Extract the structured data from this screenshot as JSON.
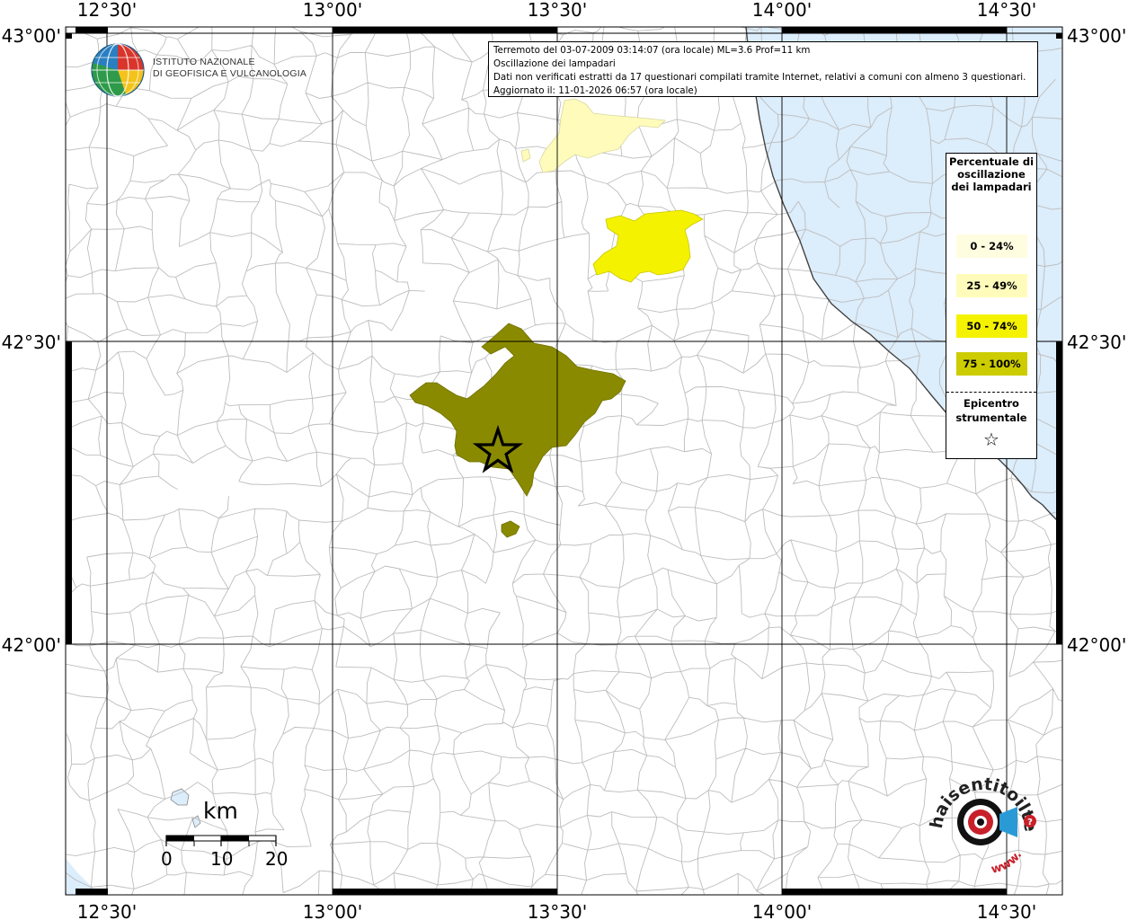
{
  "map": {
    "lon_ticks": [
      "12°30'",
      "13°00'",
      "13°30'",
      "14°00'",
      "14°30'"
    ],
    "lat_ticks": [
      "43°00'",
      "42°30'",
      "42°00'"
    ],
    "colors": {
      "sea": "#dcedfb",
      "land": "#ffffff",
      "border": "#bdbdbd",
      "grid": "#000000",
      "class_0_24": "#fffde0",
      "class_25_49": "#fffcbb",
      "class_50_74": "#f5f200",
      "class_75_100": "#8a8a00"
    },
    "epicentre_icon": "star-icon"
  },
  "info": {
    "line1": "Terremoto del 03-07-2009 03:14:07 (ora locale) ML=3.6 Prof=11 km",
    "line2": "Oscillazione dei lampadari",
    "line3": "Dati non verificati estratti da 17 questionari compilati tramite Internet, relativi a comuni con almeno 3 questionari.",
    "line4": "Aggiornato il: 11-01-2026 06:57 (ora locale)"
  },
  "legend": {
    "title": "Percentuale di oscillazione dei lampadari",
    "classes": [
      {
        "label": "0 - 24%",
        "color": "#fffde0"
      },
      {
        "label": "25 - 49%",
        "color": "#fffcbb"
      },
      {
        "label": "50 - 74%",
        "color": "#f5f200"
      },
      {
        "label": "75 - 100%",
        "color": "#cccc00"
      }
    ],
    "epicentre_label": "Epicentro strumentale",
    "epicentre_symbol": "☆"
  },
  "logo": {
    "line1": "ISTITUTO NAZIONALE",
    "line2": "DI GEOFISICA E VULCANOLOGIA",
    "icon": "globe-icon"
  },
  "scalebar": {
    "unit": "km",
    "labels": [
      "0",
      "10",
      "20"
    ]
  },
  "watermark": {
    "text": "haisentitoilterremoto.it",
    "prefix": "www.",
    "icon": "speaker-icon"
  }
}
